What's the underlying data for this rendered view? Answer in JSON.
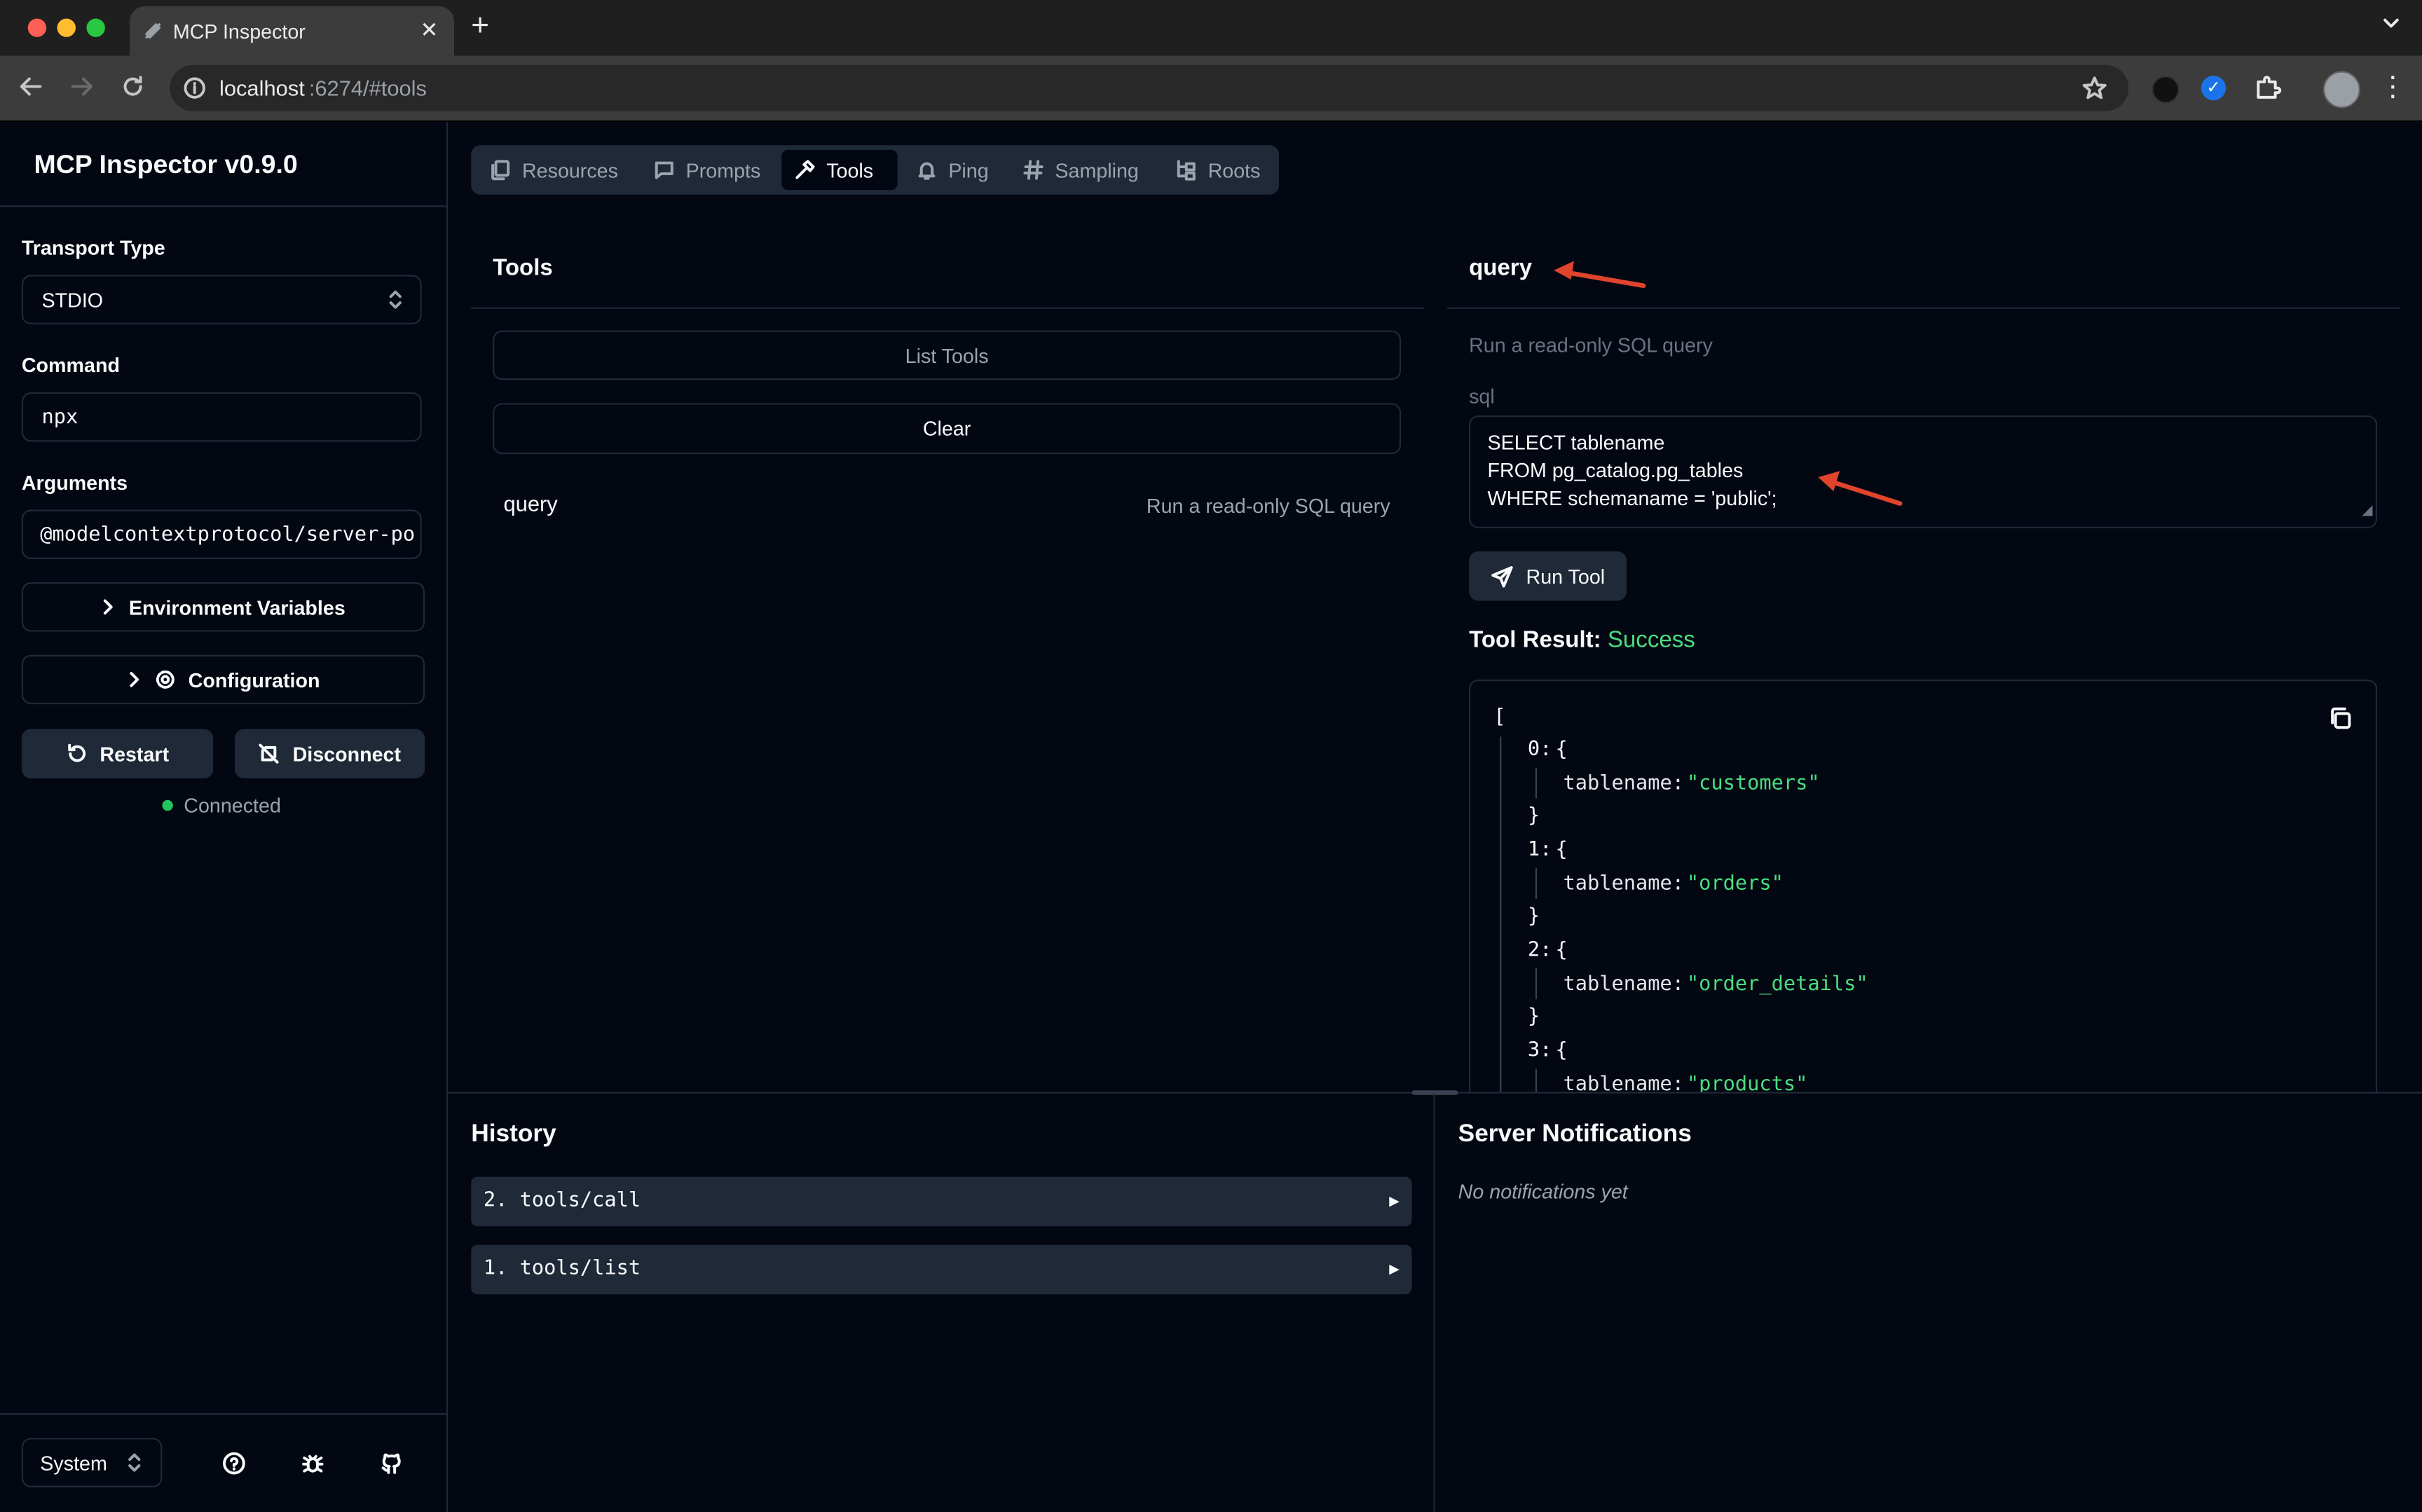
{
  "browser": {
    "tab_title": "MCP Inspector",
    "url_host": "localhost",
    "url_rest": ":6274/#tools"
  },
  "sidebar": {
    "app_title": "MCP Inspector v0.9.0",
    "transport_label": "Transport Type",
    "transport_value": "STDIO",
    "command_label": "Command",
    "command_value": "npx",
    "arguments_label": "Arguments",
    "arguments_value": "@modelcontextprotocol/server-po",
    "env_button": "Environment Variables",
    "config_button": "Configuration",
    "restart_button": "Restart",
    "disconnect_button": "Disconnect",
    "status": "Connected",
    "theme_value": "System"
  },
  "nav_tabs": [
    {
      "label": "Resources",
      "icon": "files-icon"
    },
    {
      "label": "Prompts",
      "icon": "message-icon"
    },
    {
      "label": "Tools",
      "icon": "hammer-icon"
    },
    {
      "label": "Ping",
      "icon": "bell-icon"
    },
    {
      "label": "Sampling",
      "icon": "hash-icon"
    },
    {
      "label": "Roots",
      "icon": "folder-tree-icon"
    }
  ],
  "tools_panel": {
    "title": "Tools",
    "list_button": "List Tools",
    "clear_button": "Clear",
    "tools": [
      {
        "name": "query",
        "description": "Run a read-only SQL query"
      }
    ]
  },
  "tool_detail": {
    "name": "query",
    "description": "Run a read-only SQL query",
    "param_label": "sql",
    "sql_lines": [
      "SELECT tablename",
      "FROM pg_catalog.pg_tables",
      "WHERE schemaname = 'public';"
    ],
    "run_button": "Run Tool",
    "result_label": "Tool Result:",
    "result_status": "Success",
    "result_open": "[",
    "results": [
      {
        "index": "0:",
        "key": "tablename:",
        "value": "\"customers\""
      },
      {
        "index": "1:",
        "key": "tablename:",
        "value": "\"orders\""
      },
      {
        "index": "2:",
        "key": "tablename:",
        "value": "\"order_details\""
      },
      {
        "index": "3:",
        "key": "tablename:",
        "value": "\"products\""
      }
    ],
    "open_brace": "{",
    "close_brace": "}"
  },
  "history": {
    "title": "History",
    "items": [
      "2. tools/call",
      "1. tools/list"
    ],
    "expand_glyph": "▶"
  },
  "notifications": {
    "title": "Server Notifications",
    "empty": "No notifications yet"
  },
  "colors": {
    "background": "#030712",
    "border": "#1f2937",
    "success": "#4ade80",
    "annotation_arrow": "#e0442c"
  }
}
